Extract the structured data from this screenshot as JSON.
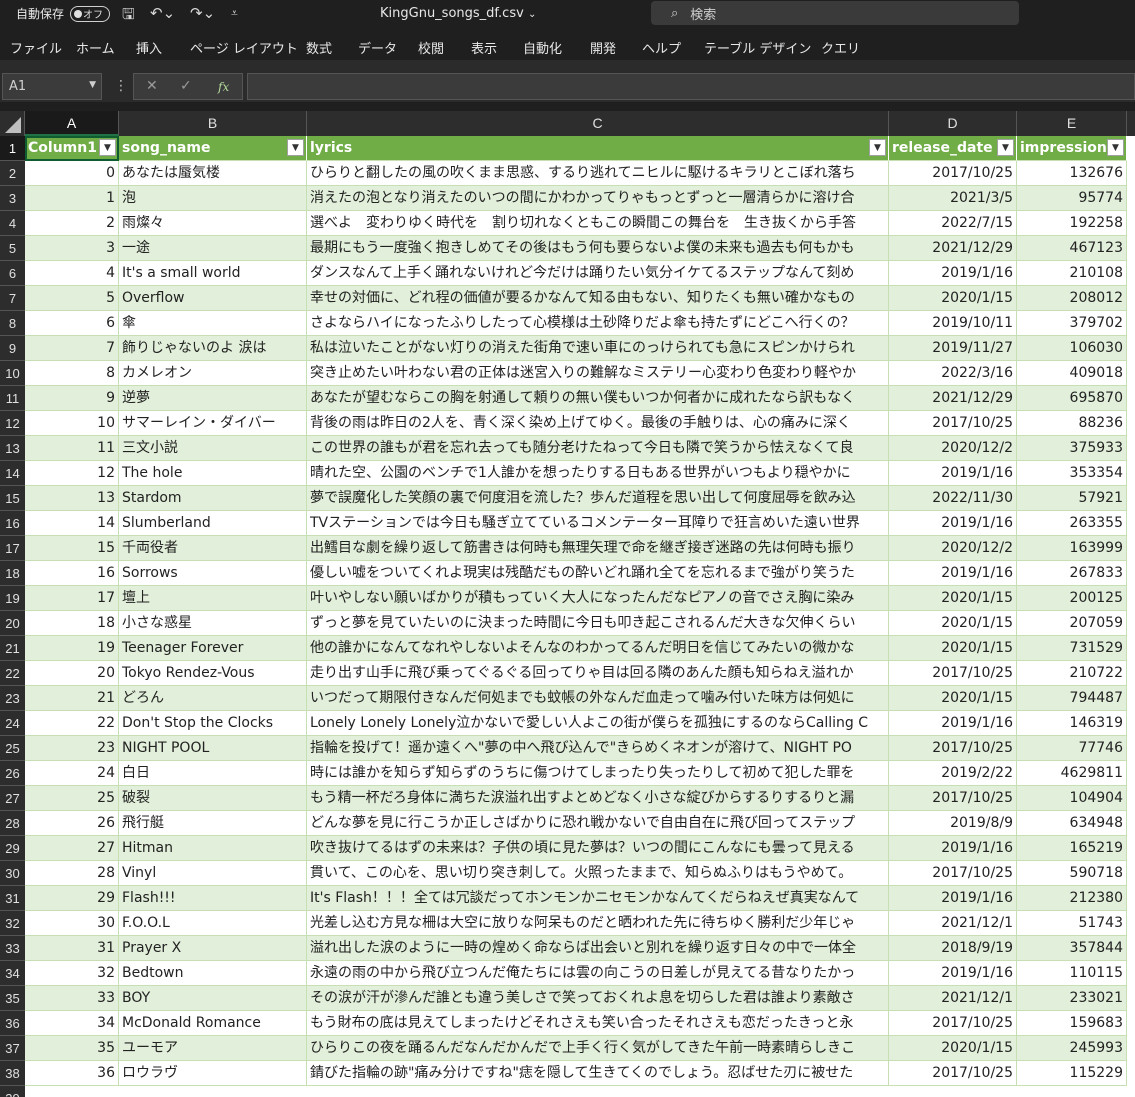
{
  "window": {
    "autosave_label": "自動保存",
    "autosave_state": "オフ",
    "filename": "KingGnu_songs_df.csv",
    "search_placeholder": "検索"
  },
  "menu": [
    "ファイル",
    "ホーム",
    "挿入",
    "ページ レイアウト",
    "数式",
    "データ",
    "校閲",
    "表示",
    "自動化",
    "開発",
    "ヘルプ",
    "テーブル デザイン",
    "クエリ"
  ],
  "formula_bar": {
    "name_box": "A1",
    "fx": "fx"
  },
  "columns": [
    "A",
    "B",
    "C",
    "D",
    "E"
  ],
  "table_headers": [
    "Column1",
    "song_name",
    "lyrics",
    "release_date",
    "impression"
  ],
  "rows": [
    [
      "0",
      "あなたは蜃気楼",
      "ひらりと翻したの風の吹くまま思惑、するり逃れてニヒルに駆けるキラリとこぼれ落ち",
      "2017/10/25",
      "132676"
    ],
    [
      "1",
      "泡",
      "消えたの泡となり消えたのいつの間にかわかってりゃもっとずっと一層清らかに溶け合",
      "2021/3/5",
      "95774"
    ],
    [
      "2",
      "雨燦々",
      "選べよ　変わりゆく時代を　割り切れなくともこの瞬間この舞台を　生き抜くから手答",
      "2022/7/15",
      "192258"
    ],
    [
      "3",
      "一途",
      "最期にもう一度強く抱きしめてその後はもう何も要らないよ僕の未来も過去も何もかも",
      "2021/12/29",
      "467123"
    ],
    [
      "4",
      "It's a small world",
      "ダンスなんて上手く踊れないけれど今だけは踊りたい気分イケてるステップなんて刻め",
      "2019/1/16",
      "210108"
    ],
    [
      "5",
      "Overflow",
      "幸せの対価に、どれ程の価値が要るかなんて知る由もない、知りたくも無い確かなもの",
      "2020/1/15",
      "208012"
    ],
    [
      "6",
      "傘",
      "さよならハイになったふりしたって心模様は土砂降りだよ傘も持たずにどこへ行くの？",
      "2019/10/11",
      "379702"
    ],
    [
      "7",
      "飾りじゃないのよ 涙は",
      "私は泣いたことがない灯りの消えた街角で速い車にのっけられても急にスピンかけられ",
      "2019/11/27",
      "106030"
    ],
    [
      "8",
      "カメレオン",
      "突き止めたい叶わない君の正体は迷宮入りの難解なミステリー心変わり色変わり軽やか",
      "2022/3/16",
      "409018"
    ],
    [
      "9",
      "逆夢",
      "あなたが望むならこの胸を射通して頼りの無い僕もいつか何者かに成れたなら訳もなく",
      "2021/12/29",
      "695870"
    ],
    [
      "10",
      "サマーレイン・ダイバー",
      "背後の雨は昨日の2人を、青く深く染め上げてゆく。最後の手触りは、心の痛みに深く",
      "2017/10/25",
      "88236"
    ],
    [
      "11",
      "三文小説",
      "この世界の誰もが君を忘れ去っても随分老けたねって今日も隣で笑うから怯えなくて良",
      "2020/12/2",
      "375933"
    ],
    [
      "12",
      "The hole",
      "晴れた空、公園のベンチで1人誰かを想ったりする日もある世界がいつもより穏やかに",
      "2019/1/16",
      "353354"
    ],
    [
      "13",
      "Stardom",
      "夢で誤魔化した笑顔の裏で何度泪を流した？歩んだ道程を思い出して何度屈辱を飲み込",
      "2022/11/30",
      "57921"
    ],
    [
      "14",
      "Slumberland",
      "TVステーションでは今日も騒ぎ立てているコメンテーター耳障りで狂言めいた遠い世界",
      "2019/1/16",
      "263355"
    ],
    [
      "15",
      "千両役者",
      "出鱈目な劇を繰り返して筋書きは何時も無理矢理で命を継ぎ接ぎ迷路の先は何時も振り",
      "2020/12/2",
      "163999"
    ],
    [
      "16",
      "Sorrows",
      "優しい嘘をついてくれよ現実は残酷だもの酔いどれ踊れ全てを忘れるまで強がり笑うた",
      "2019/1/16",
      "267833"
    ],
    [
      "17",
      "壇上",
      "叶いやしない願いばかりが積もっていく大人になったんだなピアノの音でさえ胸に染み",
      "2020/1/15",
      "200125"
    ],
    [
      "18",
      "小さな惑星",
      "ずっと夢を見ていたいのに決まった時間に今日も叩き起こされるんだ大きな欠伸くらい",
      "2020/1/15",
      "207059"
    ],
    [
      "19",
      "Teenager Forever",
      "他の誰かになんてなれやしないよそんなのわかってるんだ明日を信じてみたいの微かな",
      "2020/1/15",
      "731529"
    ],
    [
      "20",
      "Tokyo Rendez-Vous",
      "走り出す山手に飛び乗ってぐるぐる回ってりゃ目は回る隣のあんた顔も知らねえ溢れか",
      "2017/10/25",
      "210722"
    ],
    [
      "21",
      "どろん",
      "いつだって期限付きなんだ何処までも蚊帳の外なんだ血走って噛み付いた味方は何処に",
      "2020/1/15",
      "794487"
    ],
    [
      "22",
      "Don't Stop the Clocks",
      "Lonely Lonely Lonely泣かないで愛しい人よこの街が僕らを孤独にするのならCalling C",
      "2019/1/16",
      "146319"
    ],
    [
      "23",
      "NIGHT POOL",
      "指輪を投げて！遥か遠くへ\"夢の中へ飛び込んで\"きらめくネオンが溶けて、NIGHT PO",
      "2017/10/25",
      "77746"
    ],
    [
      "24",
      "白日",
      "時には誰かを知らず知らずのうちに傷つけてしまったり失ったりして初めて犯した罪を",
      "2019/2/22",
      "4629811"
    ],
    [
      "25",
      "破裂",
      "もう精一杯だろ身体に満ちた涙溢れ出すよとめどなく小さな綻びからするりするりと漏",
      "2017/10/25",
      "104904"
    ],
    [
      "26",
      "飛行艇",
      "どんな夢を見に行こうか正しさばかりに恐れ戦かないで自由自在に飛び回ってステップ",
      "2019/8/9",
      "634948"
    ],
    [
      "27",
      "Hitman",
      "吹き抜けてるはずの未来は？子供の頃に見た夢は？いつの間にこんなにも曇って見える",
      "2019/1/16",
      "165219"
    ],
    [
      "28",
      "Vinyl",
      "貫いて、この心を、思い切り突き刺して。火照ったままで、知らぬふりはもうやめて。",
      "2017/10/25",
      "590718"
    ],
    [
      "29",
      "Flash!!!",
      "It's Flash！！！全ては冗談だってホンモンかニセモンかなんてくだらねえぜ真実なんて",
      "2019/1/16",
      "212380"
    ],
    [
      "30",
      "F.O.O.L",
      "光差し込む方見な柵は大空に放りな阿呆ものだと晒われた先に待ちゆく勝利だ少年じゃ",
      "2021/12/1",
      "51743"
    ],
    [
      "31",
      "Prayer X",
      "溢れ出した涙のように一時の煌めく命ならば出会いと別れを繰り返す日々の中で一体全",
      "2018/9/19",
      "357844"
    ],
    [
      "32",
      "Bedtown",
      "永遠の雨の中から飛び立つんだ俺たちには雲の向こうの日差しが見えてる昔なりたかっ",
      "2019/1/16",
      "110115"
    ],
    [
      "33",
      "BOY",
      "その涙が汗が滲んだ誰とも違う美しさで笑っておくれよ息を切らした君は誰より素敵さ",
      "2021/12/1",
      "233021"
    ],
    [
      "34",
      "McDonald Romance",
      "もう財布の底は見えてしまったけどそれさえも笑い合ったそれさえも恋だったきっと永",
      "2017/10/25",
      "159683"
    ],
    [
      "35",
      "ユーモア",
      "ひらりこの夜を踊るんだなんだかんだで上手く行く気がしてきた午前一時素晴らしきこ",
      "2020/1/15",
      "245993"
    ],
    [
      "36",
      "ロウラヴ",
      "錆びた指輪の跡\"痛み分けですね\"痣を隠して生きてくのでしょう。忍ばせた刃に被せた",
      "2017/10/25",
      "115229"
    ]
  ],
  "colors": {
    "table_header": "#70ad47",
    "band": "#e2efda",
    "selection": "#217346"
  }
}
